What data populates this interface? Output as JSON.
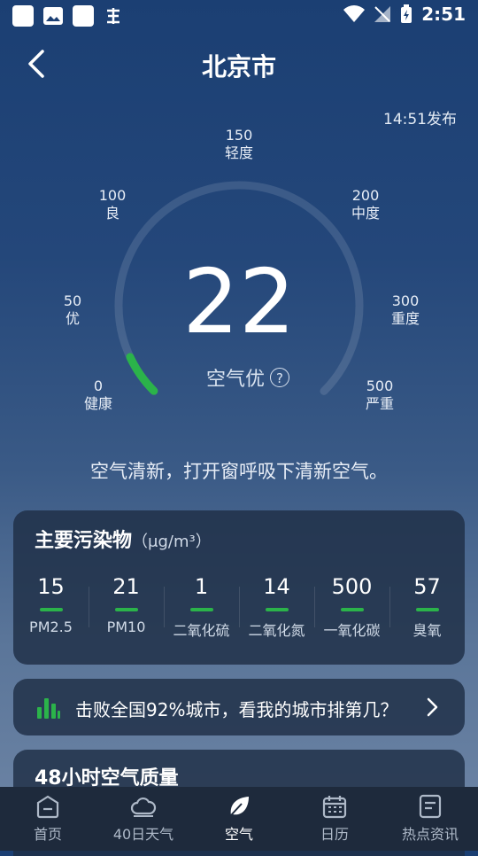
{
  "status": {
    "time": "2:51"
  },
  "header": {
    "title": "北京市"
  },
  "publish_time": "14:51发布",
  "gauge": {
    "value": "22",
    "level": "空气优",
    "help": "?",
    "ticks": [
      {
        "value": "0",
        "label": "健康"
      },
      {
        "value": "50",
        "label": "优"
      },
      {
        "value": "100",
        "label": "良"
      },
      {
        "value": "150",
        "label": "轻度"
      },
      {
        "value": "200",
        "label": "中度"
      },
      {
        "value": "300",
        "label": "重度"
      },
      {
        "value": "500",
        "label": "严重"
      }
    ]
  },
  "advice": "空气清新，打开窗呼吸下清新空气。",
  "pollutants": {
    "title": "主要污染物",
    "unit": "（μg/m³）",
    "items": [
      {
        "value": "15",
        "name": "PM2.5"
      },
      {
        "value": "21",
        "name": "PM10"
      },
      {
        "value": "1",
        "name": "二氧化硫"
      },
      {
        "value": "14",
        "name": "二氧化氮"
      },
      {
        "value": "500",
        "name": "一氧化碳"
      },
      {
        "value": "57",
        "name": "臭氧"
      }
    ],
    "bar_color": "#2bb34a"
  },
  "rank": {
    "text": "击败全国92%城市，看我的城市排第几？"
  },
  "hourly": {
    "title": "48小时空气质量"
  },
  "nav": [
    {
      "label": "首页",
      "icon": "home-icon"
    },
    {
      "label": "40日天气",
      "icon": "cloud-icon"
    },
    {
      "label": "空气",
      "icon": "leaf-icon"
    },
    {
      "label": "日历",
      "icon": "calendar-icon"
    },
    {
      "label": "热点资讯",
      "icon": "news-icon"
    }
  ],
  "colors": {
    "accent": "#2bb34a",
    "nav_bg": "#1e2a3c"
  }
}
